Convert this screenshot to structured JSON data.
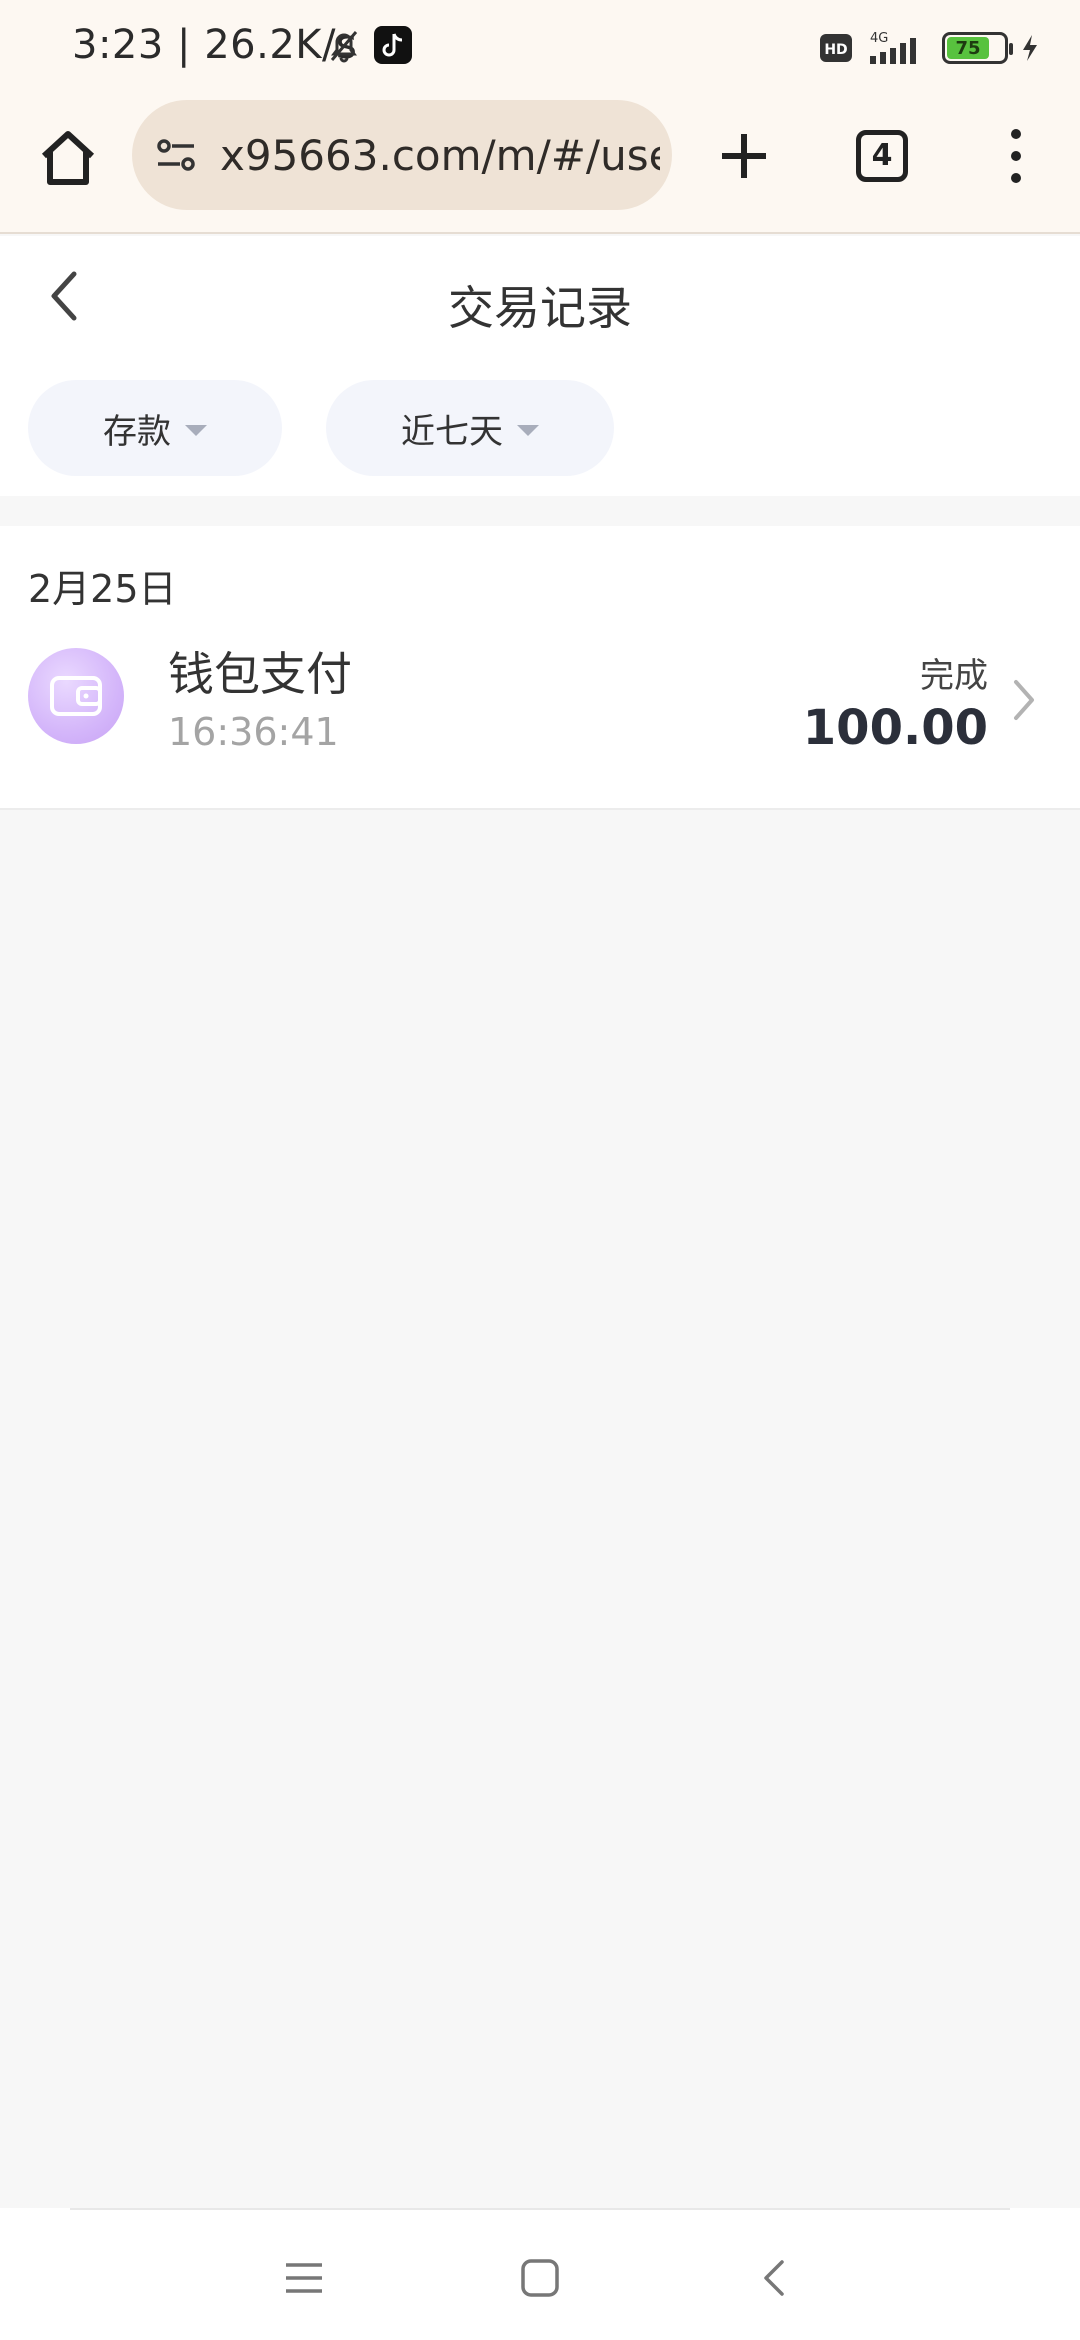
{
  "status_bar": {
    "time": "3:23 | 26.2K/s",
    "battery": "75",
    "icons": [
      "bell-off-icon",
      "tiktok-icon",
      "hd-icon",
      "signal-4g-icon",
      "battery-icon",
      "charging-icon"
    ]
  },
  "browser": {
    "url": "x95663.com/m/#/use",
    "tab_count": "4"
  },
  "header": {
    "title": "交易记录"
  },
  "filters": {
    "type_label": "存款",
    "range_label": "近七天"
  },
  "records": {
    "date": "2月25日",
    "items": [
      {
        "title": "钱包支付",
        "time": "16:36:41",
        "status": "完成",
        "amount": "100.00",
        "icon": "wallet-icon"
      }
    ]
  },
  "colors": {
    "chrome_bg": "#fdf8f2",
    "urlbar_bg": "#efe3d6",
    "filter_bg": "#f3f5fb",
    "avatar_purple": "#c7a2f5",
    "page_bg": "#f7f7f7"
  }
}
